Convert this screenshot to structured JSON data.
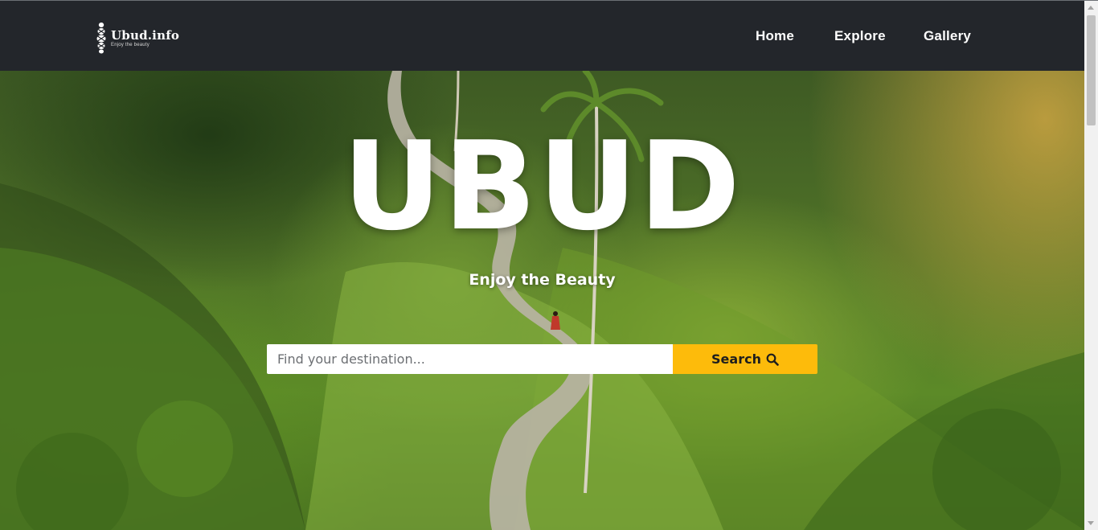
{
  "brand": {
    "name": "Ubud.info",
    "tagline": "Enjoy the beauty",
    "logo_icon": "footprint-icon"
  },
  "nav": {
    "items": [
      {
        "label": "Home"
      },
      {
        "label": "Explore"
      },
      {
        "label": "Gallery"
      }
    ]
  },
  "hero": {
    "title": "UBUD",
    "subtitle": "Enjoy the Beauty",
    "search": {
      "placeholder": "Find your destination...",
      "value": "",
      "button_label": "Search",
      "button_icon": "search-icon"
    }
  },
  "colors": {
    "navbar_bg": "#23262b",
    "accent": "#fdbb0b",
    "text_light": "#ffffff"
  }
}
